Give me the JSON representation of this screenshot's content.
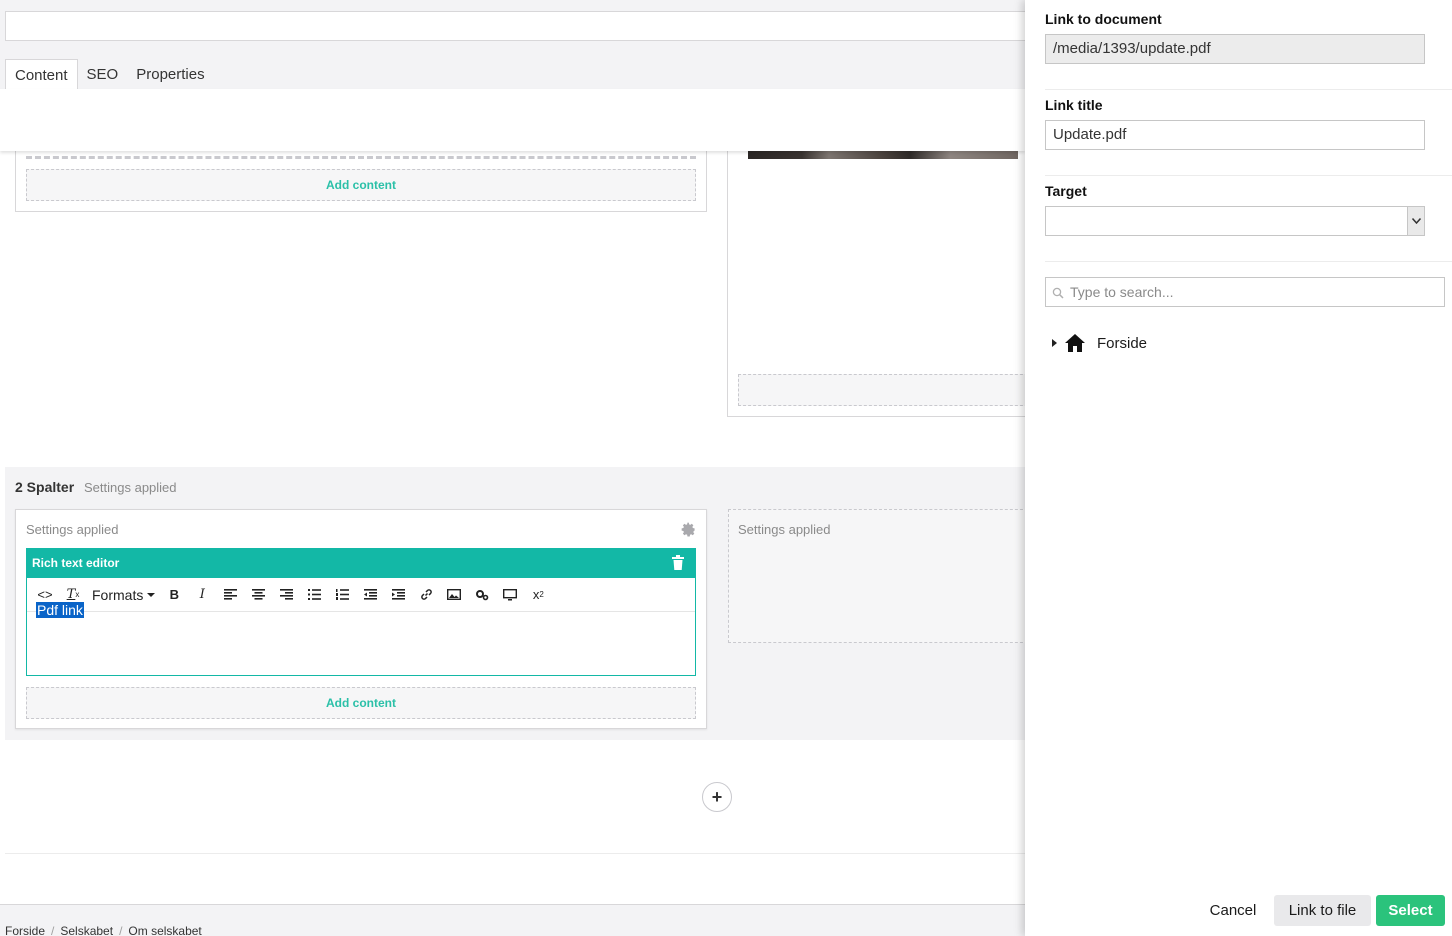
{
  "editor": {
    "tabs": [
      {
        "label": "Content",
        "active": true
      },
      {
        "label": "SEO",
        "active": false
      },
      {
        "label": "Properties",
        "active": false
      }
    ],
    "grid_top": {
      "add_content_label": "Add content"
    },
    "section2": {
      "title": "2 Spalter",
      "subtitle": "Settings applied",
      "col_left_settings": "Settings applied",
      "rte_title": "Rich text editor",
      "toolbar_formats": "Formats",
      "rte_text": "Pdf link",
      "add_content_label": "Add content",
      "col_right_settings": "Settings applied"
    },
    "breadcrumb": [
      "Forside",
      "Selskabet",
      "Om selskabet"
    ]
  },
  "panel": {
    "link_label": "Link to document",
    "link_value": "/media/1393/update.pdf",
    "title_label": "Link title",
    "title_value": "Update.pdf",
    "target_label": "Target",
    "target_value": "",
    "search_placeholder": "Type to search...",
    "tree_root": "Forside",
    "buttons": {
      "cancel": "Cancel",
      "link_to_file": "Link to file",
      "select": "Select"
    }
  },
  "colors": {
    "accent_teal": "#13b8a6",
    "add_content_green": "#2bc0a8",
    "select_green": "#2bc37c",
    "selection_blue": "#0a64c8"
  },
  "icons": [
    "gear-icon",
    "trash-icon",
    "code-icon",
    "clear-format-icon",
    "bold-icon",
    "italic-icon",
    "align-left-icon",
    "align-center-icon",
    "align-right-icon",
    "bullet-list-icon",
    "numbered-list-icon",
    "outdent-icon",
    "indent-icon",
    "link-icon",
    "image-icon",
    "macro-icon",
    "embed-icon",
    "superscript-icon",
    "plus-icon",
    "search-icon",
    "home-icon",
    "chevron-down-icon"
  ]
}
